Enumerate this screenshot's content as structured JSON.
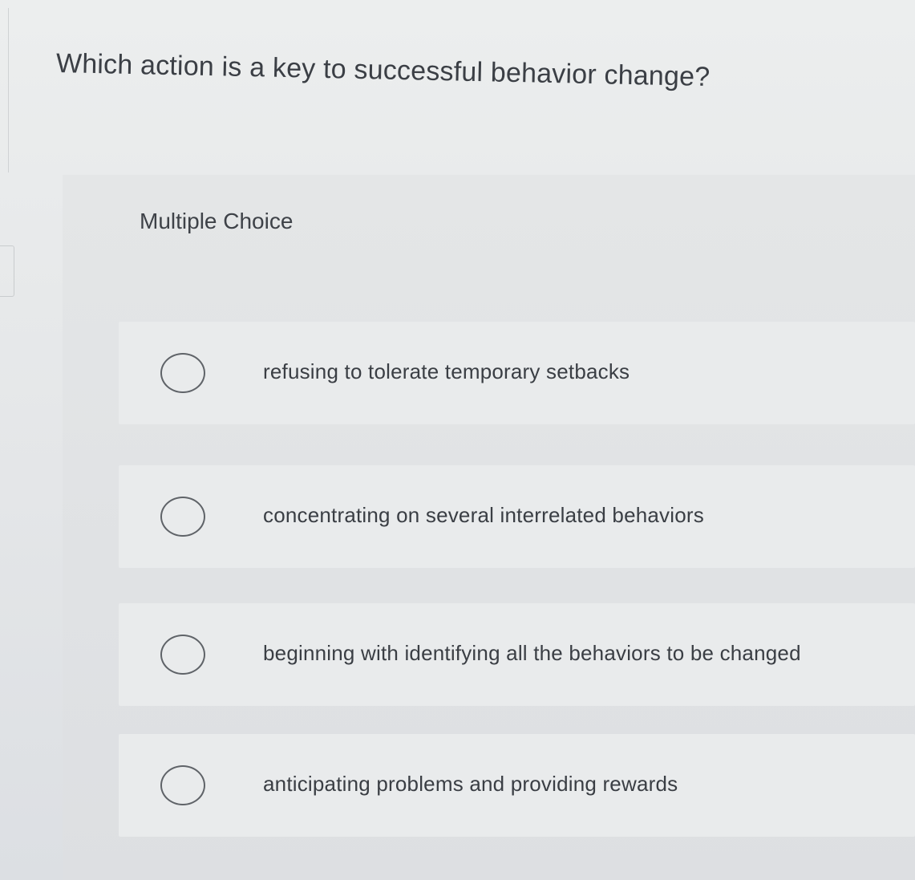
{
  "question": {
    "text": "Which action is a key to successful behavior change?"
  },
  "quiz": {
    "type_label": "Multiple Choice",
    "options": [
      {
        "label": "refusing to tolerate temporary setbacks",
        "selected": false
      },
      {
        "label": "concentrating on several interrelated behaviors",
        "selected": false
      },
      {
        "label": "beginning with identifying all the behaviors to be changed",
        "selected": false
      },
      {
        "label": "anticipating problems and providing rewards",
        "selected": false
      }
    ]
  }
}
